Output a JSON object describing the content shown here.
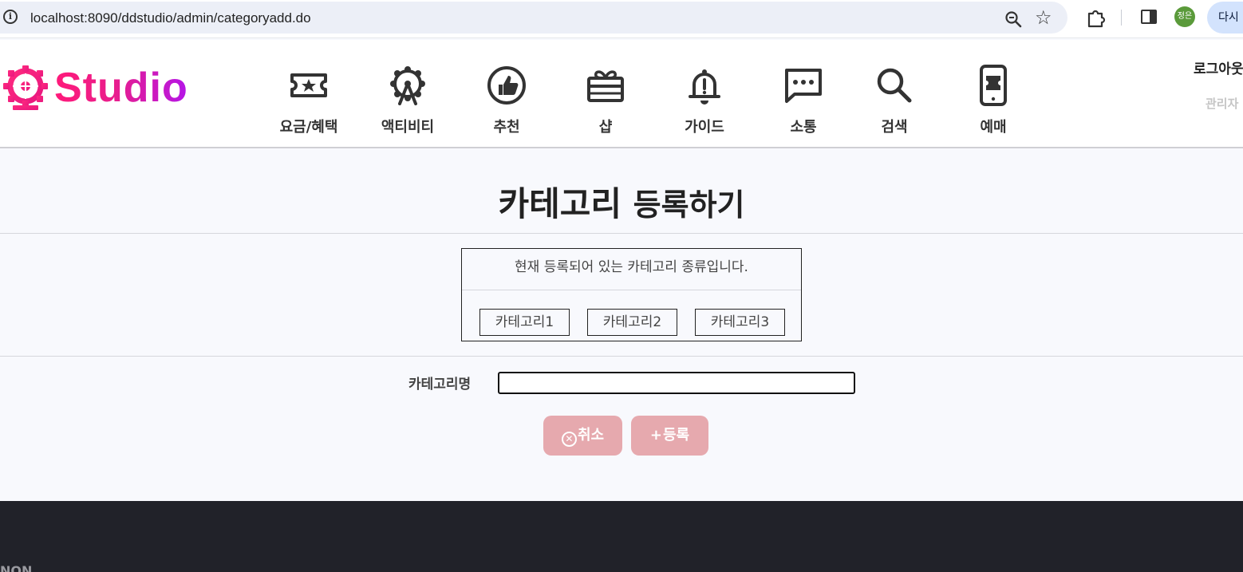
{
  "browser": {
    "url": "localhost:8090/ddstudio/admin/categoryadd.do",
    "profile_initials": "정은",
    "relaunch_label": "다시"
  },
  "header": {
    "logo_text": "Studio",
    "nav": [
      {
        "label": "요금/혜택",
        "icon": "ticket-icon"
      },
      {
        "label": "액티비티",
        "icon": "ferris-wheel-icon"
      },
      {
        "label": "추천",
        "icon": "thumbs-up-icon"
      },
      {
        "label": "샵",
        "icon": "gift-box-icon"
      },
      {
        "label": "가이드",
        "icon": "bell-icon"
      },
      {
        "label": "소통",
        "icon": "chat-bubble-icon"
      },
      {
        "label": "검색",
        "icon": "search-icon"
      },
      {
        "label": "예매",
        "icon": "mobile-ticket-icon"
      }
    ],
    "logout_label": "로그아웃",
    "admin_label": "관리자"
  },
  "main": {
    "title_main": "카테고리",
    "title_sub": "등록하기",
    "existing_caption": "현재 등록되어 있는 카테고리 종류입니다.",
    "categories": [
      "카테고리1",
      "카테고리2",
      "카테고리3"
    ],
    "form_label": "카테고리명",
    "input_value": "",
    "cancel_label": "취소",
    "submit_label": "등록"
  },
  "footer": {
    "text": "NON"
  },
  "colors": {
    "brand_gradient_start": "#ff1a7a",
    "brand_gradient_end": "#b415e8",
    "button_bg": "#e6a9ae",
    "footer_bg": "#212229"
  }
}
